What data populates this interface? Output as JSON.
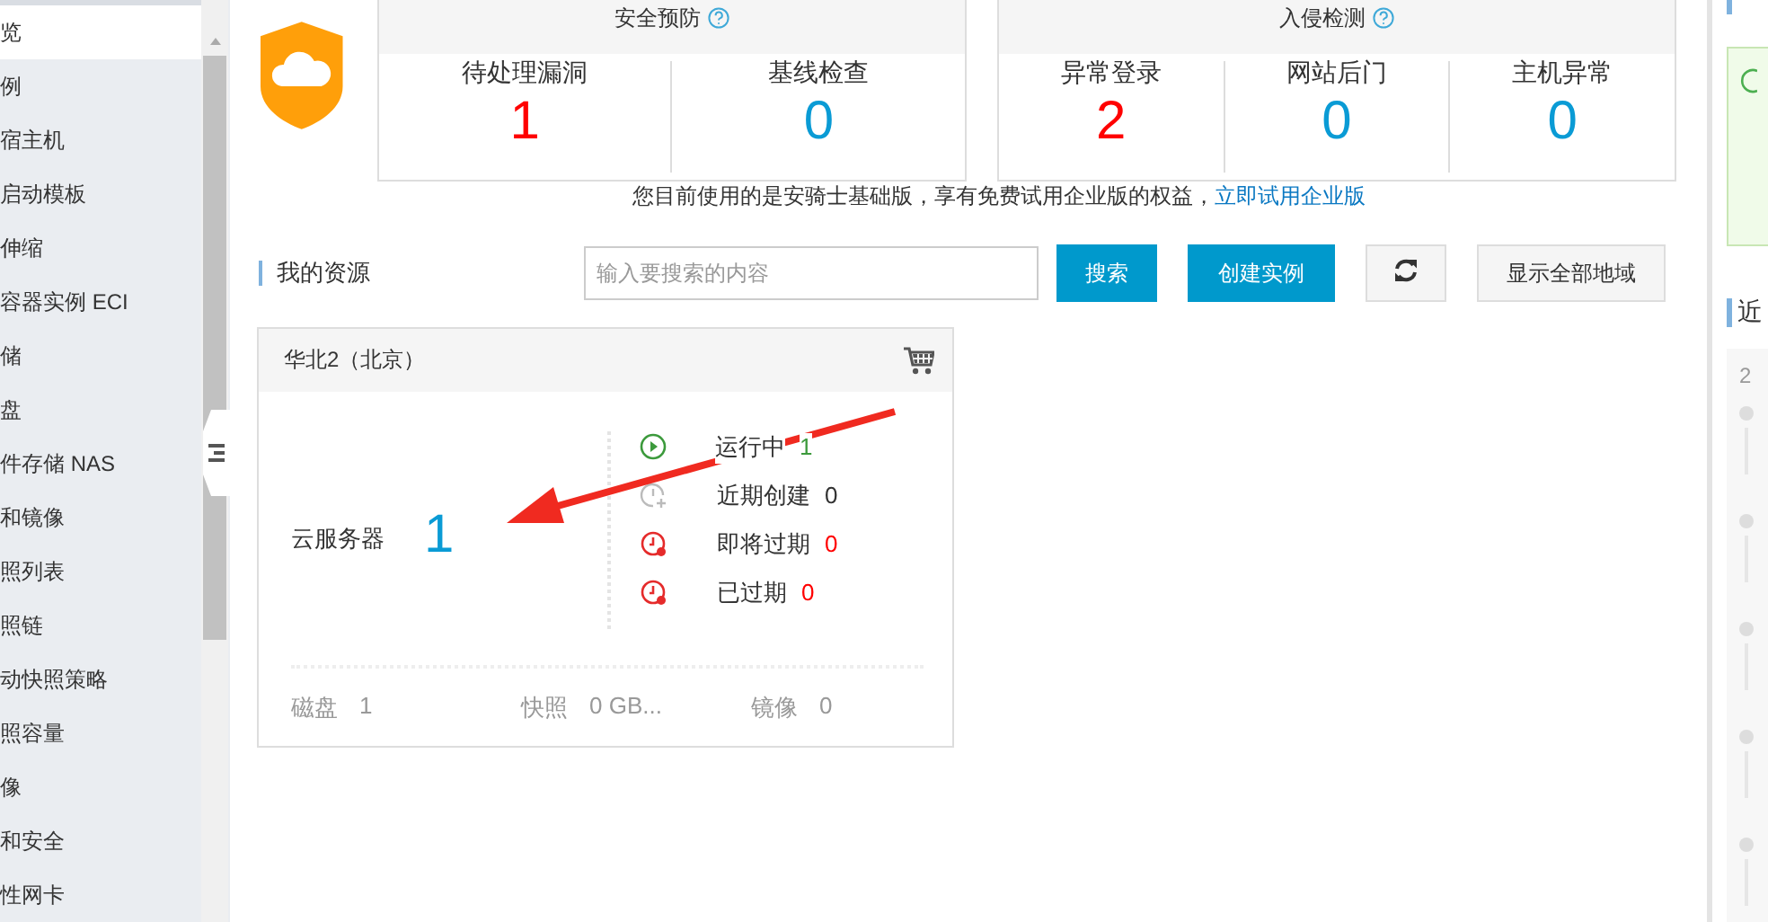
{
  "sidebar": {
    "items": [
      {
        "label": "览",
        "selected": true
      },
      {
        "label": "例",
        "selected": false
      },
      {
        "label": "宿主机",
        "selected": false
      },
      {
        "label": "启动模板",
        "selected": false
      },
      {
        "label": "伸缩",
        "selected": false
      },
      {
        "label": "容器实例 ECI",
        "selected": false
      },
      {
        "label": "储",
        "selected": false
      },
      {
        "label": "盘",
        "selected": false
      },
      {
        "label": "件存储 NAS",
        "selected": false
      },
      {
        "label": "和镜像",
        "selected": false
      },
      {
        "label": "照列表",
        "selected": false
      },
      {
        "label": "照链",
        "selected": false
      },
      {
        "label": "动快照策略",
        "selected": false
      },
      {
        "label": "照容量",
        "selected": false
      },
      {
        "label": "像",
        "selected": false
      },
      {
        "label": "和安全",
        "selected": false
      },
      {
        "label": "性网卡",
        "selected": false
      }
    ]
  },
  "security": {
    "groups": [
      {
        "title": "安全预防",
        "stats": [
          {
            "label": "待处理漏洞",
            "value": "1",
            "alert": true
          },
          {
            "label": "基线检查",
            "value": "0",
            "alert": false
          }
        ]
      },
      {
        "title": "入侵检测",
        "stats": [
          {
            "label": "异常登录",
            "value": "2",
            "alert": true
          },
          {
            "label": "网站后门",
            "value": "0",
            "alert": false
          },
          {
            "label": "主机异常",
            "value": "0",
            "alert": false
          }
        ]
      }
    ],
    "notice": "您目前使用的是安骑士基础版，享有免费试用企业版的权益，",
    "notice_link": "立即试用企业版"
  },
  "resources": {
    "title": "我的资源",
    "search": {
      "placeholder": "输入要搜索的内容"
    },
    "search_button": "搜索",
    "create_button": "创建实例",
    "regions_button": "显示全部地域",
    "card": {
      "region": "华北2（北京）",
      "product": "云服务器",
      "count": "1",
      "statuses": [
        {
          "kind": "running",
          "label": "运行中",
          "count": "1"
        },
        {
          "kind": "new",
          "label": "近期创建",
          "count": "0"
        },
        {
          "kind": "expiring",
          "label": "即将过期",
          "count": "0"
        },
        {
          "kind": "expired",
          "label": "已过期",
          "count": "0"
        }
      ],
      "footer": [
        {
          "label": "磁盘",
          "value": "1"
        },
        {
          "label": "快照",
          "value": "0 GB..."
        },
        {
          "label": "镜像",
          "value": "0"
        }
      ]
    }
  },
  "right_panel": {
    "heading": "近",
    "timeline_date": "2"
  }
}
